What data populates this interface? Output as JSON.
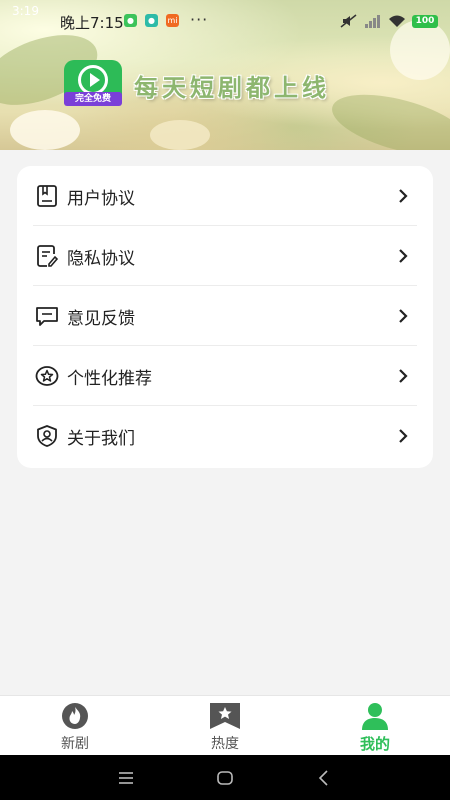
{
  "status_bar": {
    "clock_small": "3:19",
    "clock_main": "晚上7:15",
    "more_dots": "···",
    "battery": "100"
  },
  "brand": {
    "badge": "完全免费",
    "slogan": "每天短剧都上线",
    "accent_color": "#2dbb57"
  },
  "menu": {
    "items": [
      {
        "label": "用户协议",
        "icon": "document-icon"
      },
      {
        "label": "隐私协议",
        "icon": "privacy-doc-icon"
      },
      {
        "label": "意见反馈",
        "icon": "feedback-icon"
      },
      {
        "label": "个性化推荐",
        "icon": "star-badge-icon"
      },
      {
        "label": "关于我们",
        "icon": "shield-user-icon"
      }
    ]
  },
  "bottom_nav": {
    "tabs": [
      {
        "label": "新剧",
        "icon": "flame-icon",
        "active": false
      },
      {
        "label": "热度",
        "icon": "star-bookmark-icon",
        "active": false
      },
      {
        "label": "我的",
        "icon": "user-icon",
        "active": true
      }
    ],
    "active_color": "#2fbf5a"
  }
}
